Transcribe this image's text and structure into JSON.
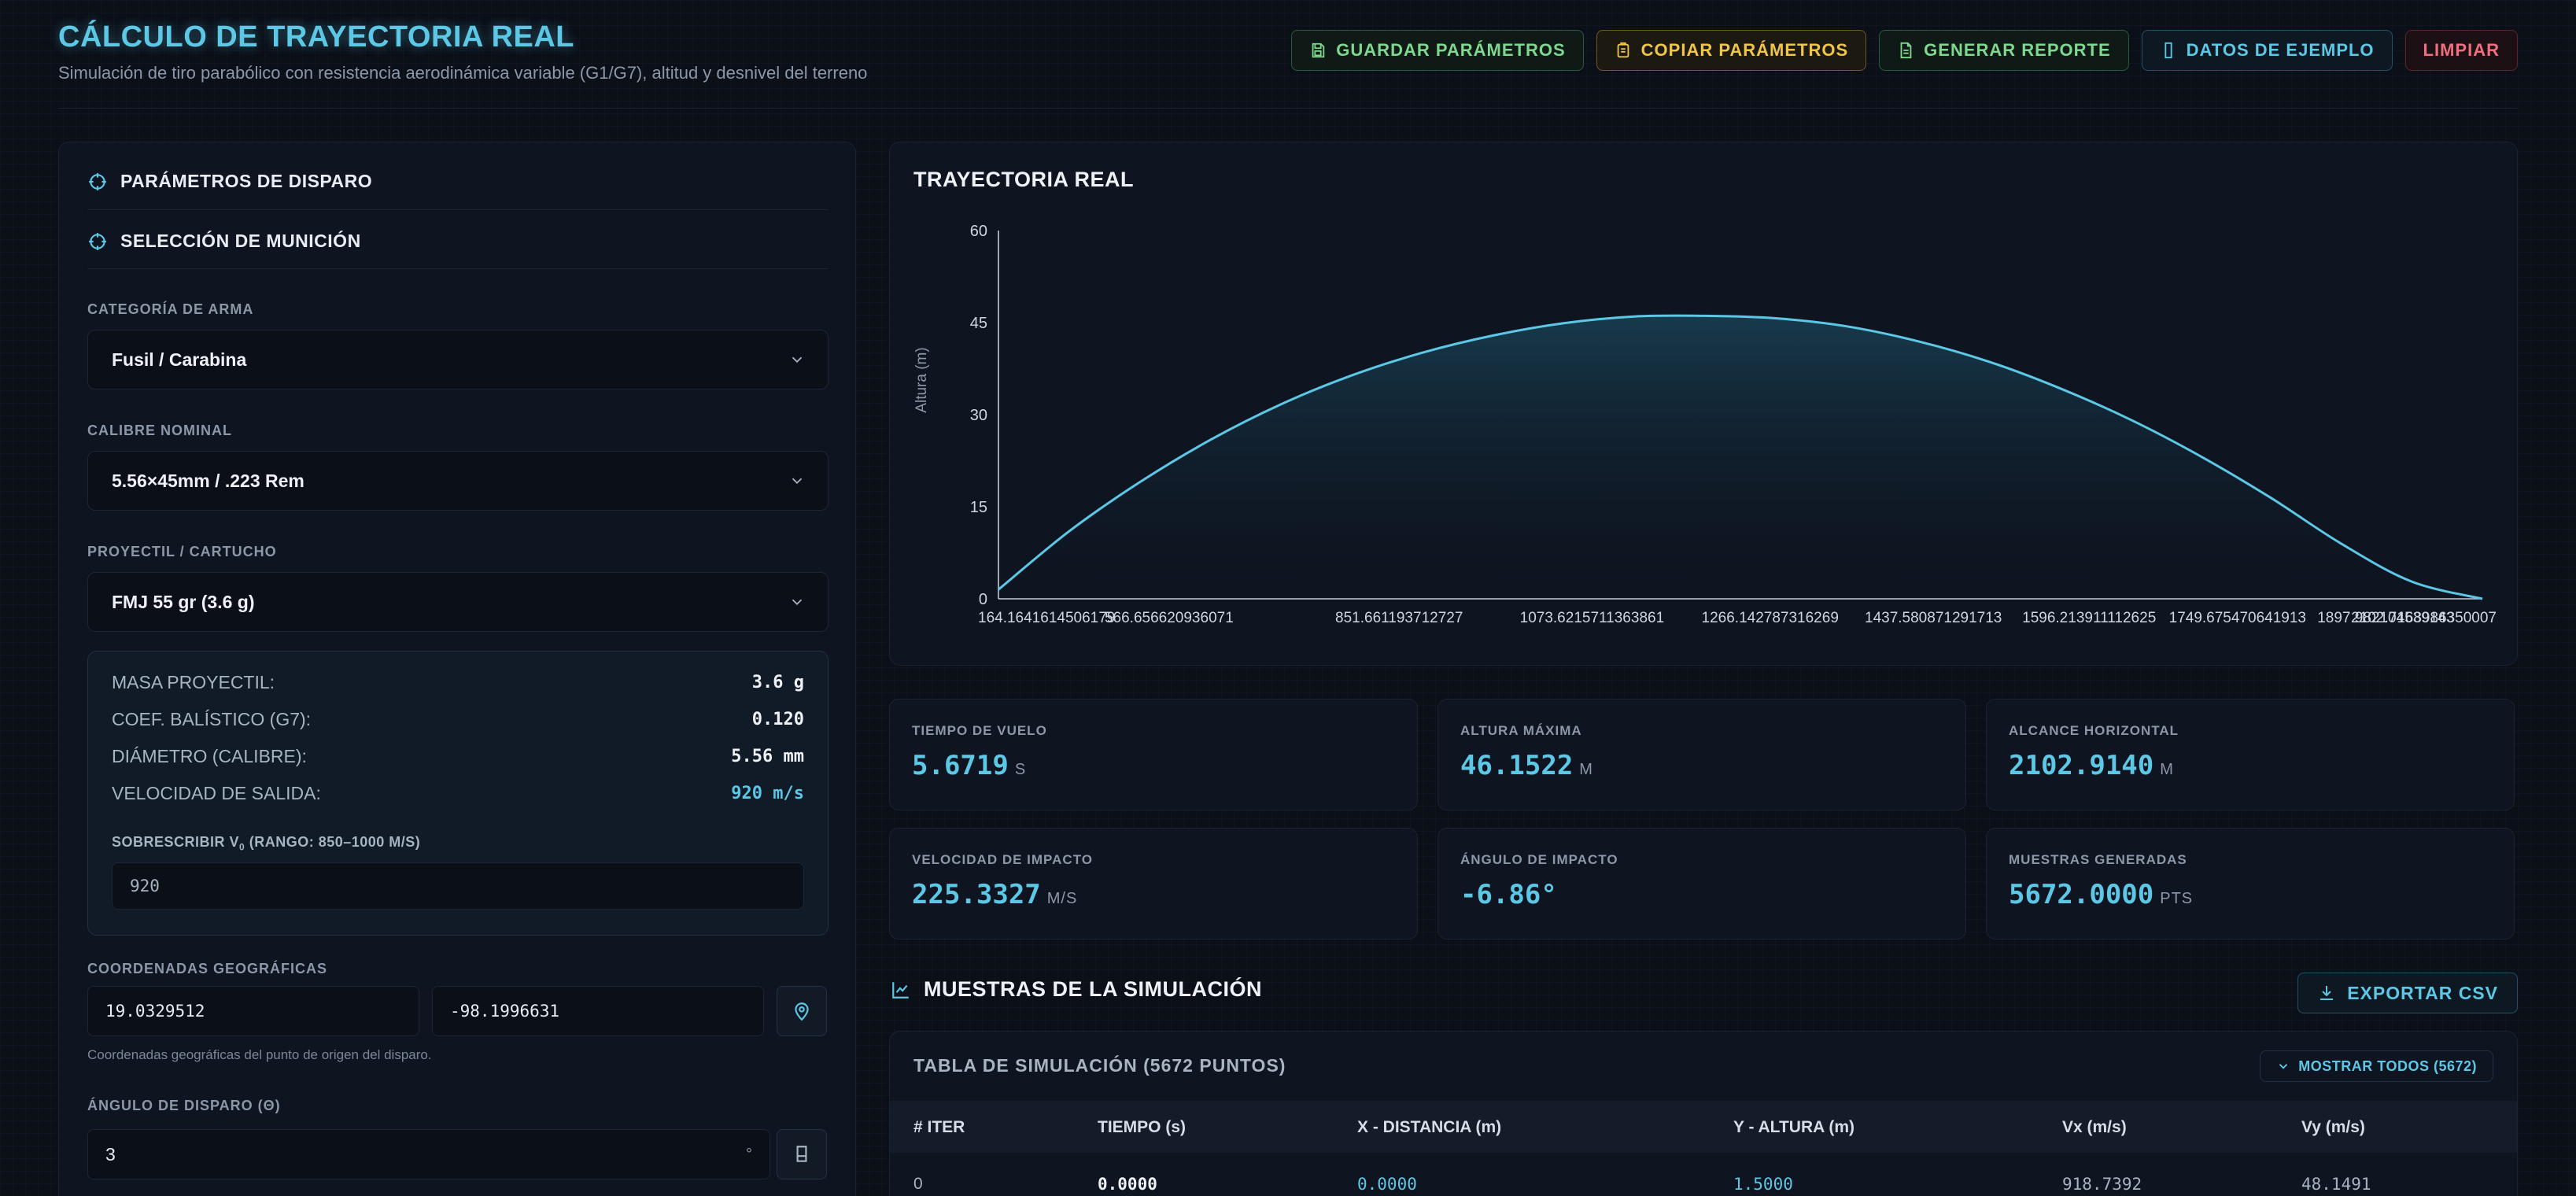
{
  "header": {
    "title": "CÁLCULO DE TRAYECTORIA REAL",
    "subtitle": "Simulación de tiro parabólico con resistencia aerodinámica variable (G1/G7), altitud y desnivel del terreno",
    "buttons": {
      "save": "GUARDAR PARÁMETROS",
      "copy": "COPIAR PARÁMETROS",
      "report": "GENERAR REPORTE",
      "sample": "DATOS DE EJEMPLO",
      "clear": "LIMPIAR"
    }
  },
  "left": {
    "section_shot": "PARÁMETROS DE DISPARO",
    "section_ammo": "SELECCIÓN DE MUNICIÓN",
    "weapon_label": "CATEGORÍA DE ARMA",
    "weapon_value": "Fusil / Carabina",
    "caliber_label": "CALIBRE NOMINAL",
    "caliber_value": "5.56×45mm / .223 Rem",
    "projectile_label": "PROYECTIL / CARTUCHO",
    "projectile_value": "FMJ 55 gr (3.6 g)",
    "specs": {
      "mass_label": "MASA PROYECTIL:",
      "mass_value": "3.6 g",
      "bc_label": "COEF. BALÍSTICO (G7):",
      "bc_value": "0.120",
      "diam_label": "DIÁMETRO (CALIBRE):",
      "diam_value": "5.56 mm",
      "vel_label": "VELOCIDAD DE SALIDA:",
      "vel_value": "920 m/s",
      "override_label_pre": "SOBRESCRIBIR V",
      "override_label_sub": "0",
      "override_label_post": " (RANGO: 850–1000 M/S)",
      "override_value": "920"
    },
    "coords_label": "COORDENADAS GEOGRÁFICAS",
    "lat": "19.0329512",
    "lon": "-98.1996631",
    "coords_hint": "Coordenadas geográficas del punto de origen del disparo.",
    "angle_label": "ÁNGULO DE DISPARO (Θ)",
    "angle_value": "3",
    "angle_unit": "°"
  },
  "chart_card": {
    "title": "TRAYECTORIA REAL"
  },
  "chart_data": {
    "type": "area",
    "title": "TRAYECTORIA REAL",
    "xlabel": "",
    "ylabel": "Altura (m)",
    "ylim": [
      0,
      60
    ],
    "yticks": [
      "0",
      "15",
      "30",
      "45",
      "60"
    ],
    "xticks": [
      "164.1641614506179",
      "566.656620936071",
      "851.661193712727",
      "1073.6215711363861",
      "1266.142787316269",
      "1437.580871291713",
      "1596.213911112625",
      "1749.675470641913",
      "1897.982104539143",
      "2102.7168986350007"
    ],
    "x": [
      0,
      100,
      200,
      300,
      400,
      500,
      600,
      700,
      800,
      900,
      1000,
      1100,
      1200,
      1300,
      1400,
      1500,
      1600,
      1700,
      1800,
      1900,
      2000,
      2100
    ],
    "y": [
      1.5,
      11.0,
      19.0,
      25.9,
      31.7,
      36.4,
      40.1,
      42.9,
      44.9,
      46.0,
      46.1,
      45.7,
      44.4,
      42.0,
      38.7,
      34.4,
      29.3,
      23.3,
      16.5,
      9.0,
      2.8,
      0.0
    ],
    "grid": false,
    "color": "#5cc8e6"
  },
  "stats": [
    {
      "label": "TIEMPO DE VUELO",
      "value": "5.6719",
      "unit": "S"
    },
    {
      "label": "ALTURA MÁXIMA",
      "value": "46.1522",
      "unit": "M"
    },
    {
      "label": "ALCANCE HORIZONTAL",
      "value": "2102.9140",
      "unit": "M"
    },
    {
      "label": "VELOCIDAD DE IMPACTO",
      "value": "225.3327",
      "unit": "M/S"
    },
    {
      "label": "ÁNGULO DE IMPACTO",
      "value": "-6.86°",
      "unit": ""
    },
    {
      "label": "MUESTRAS GENERADAS",
      "value": "5672.0000",
      "unit": "PTS"
    }
  ],
  "samples": {
    "title": "MUESTRAS DE LA SIMULACIÓN",
    "export": "EXPORTAR CSV",
    "table_title": "TABLA DE SIMULACIÓN (5672 PUNTOS)",
    "show_all": "MOSTRAR TODOS (5672)",
    "columns": [
      "# ITER",
      "TIEMPO (s)",
      "X - DISTANCIA (m)",
      "Y - ALTURA (m)",
      "Vx (m/s)",
      "Vy (m/s)"
    ],
    "rows": [
      [
        "0",
        "0.0000",
        "0.0000",
        "1.5000",
        "918.7392",
        "48.1491"
      ]
    ]
  },
  "colors": {
    "accent": "#5cc8e6",
    "green": "#7fd88f",
    "yellow": "#f0c548",
    "red": "#ef6f7f",
    "background": "#0b0f17"
  }
}
